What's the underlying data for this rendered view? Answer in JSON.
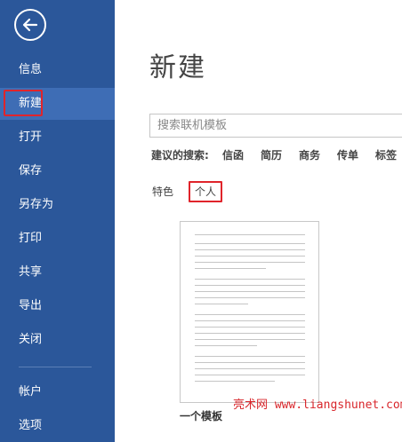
{
  "sidebar": {
    "back_label": "",
    "items": [
      {
        "label": "信息"
      },
      {
        "label": "新建"
      },
      {
        "label": "打开"
      },
      {
        "label": "保存"
      },
      {
        "label": "另存为"
      },
      {
        "label": "打印"
      },
      {
        "label": "共享"
      },
      {
        "label": "导出"
      },
      {
        "label": "关闭"
      },
      {
        "label": "帐户"
      },
      {
        "label": "选项"
      }
    ]
  },
  "main": {
    "title": "新建",
    "search": {
      "placeholder": "搜索联机模板"
    },
    "suggested": {
      "label": "建议的搜索:",
      "links": [
        "信函",
        "简历",
        "商务",
        "传单",
        "标签"
      ]
    },
    "tabs": [
      {
        "label": "特色"
      },
      {
        "label": "个人"
      }
    ],
    "template": {
      "name": "一个模板"
    }
  },
  "watermark": "亮术网 www.liangshunet.com",
  "colors": {
    "sidebar": "#2b579a",
    "sidebar_active": "#3e6db5",
    "highlight": "#e0242b"
  }
}
